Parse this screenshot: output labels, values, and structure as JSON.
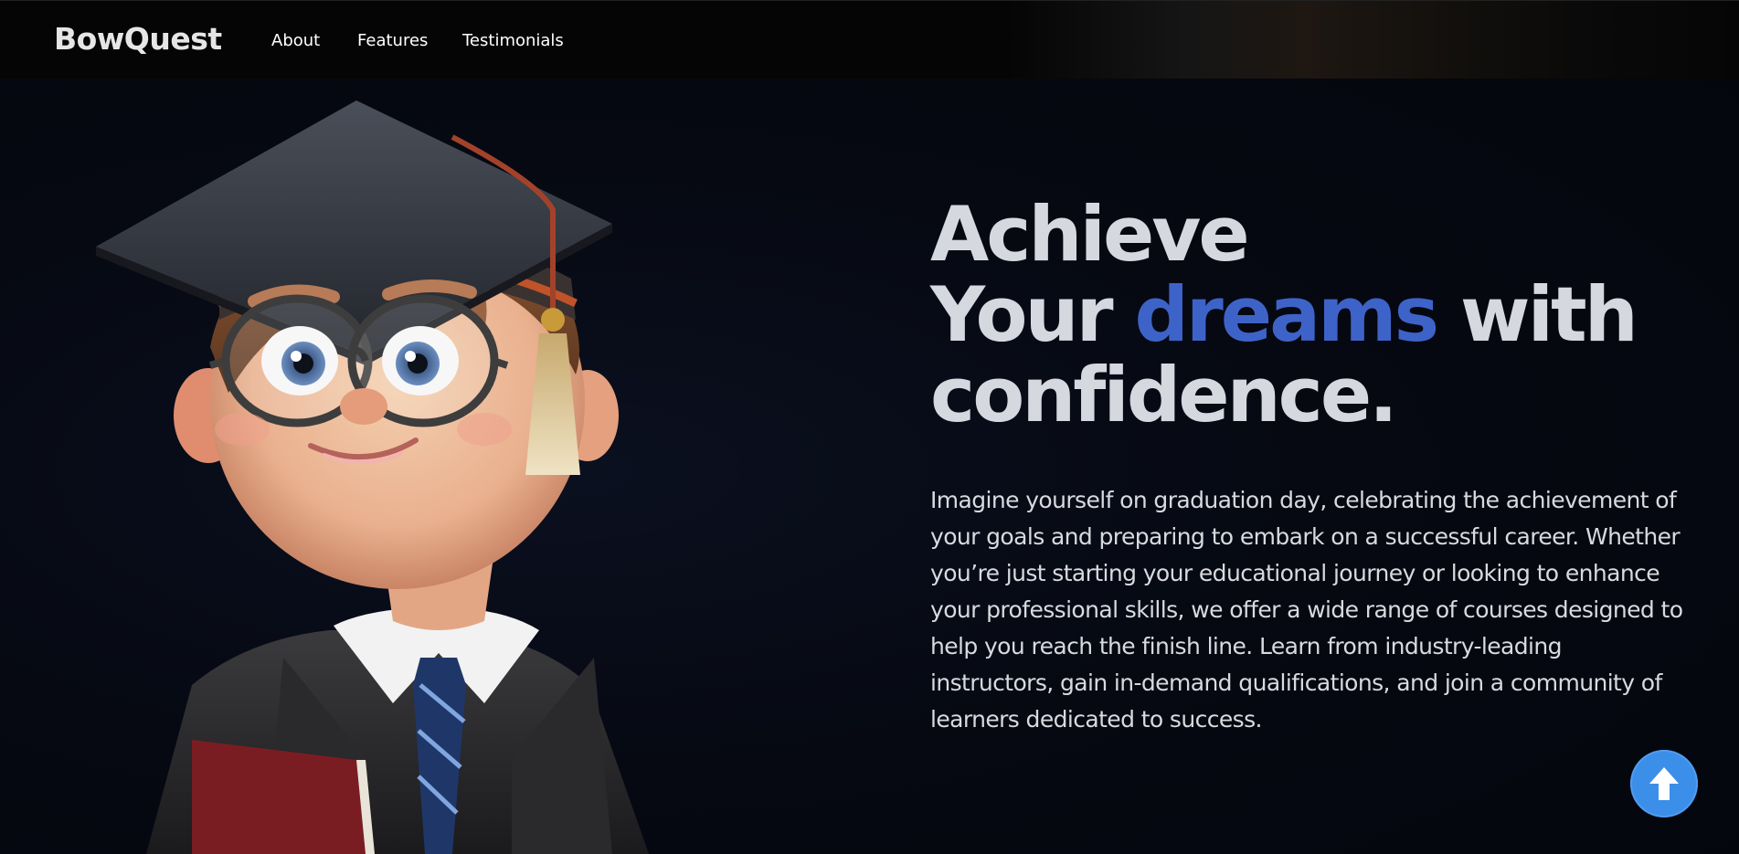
{
  "nav": {
    "brand": "BowQuest",
    "links": [
      "About",
      "Features",
      "Testimonials"
    ]
  },
  "hero": {
    "title_line1": "Achieve",
    "title_line2_start": "Your",
    "title_line2_accent": "dreams",
    "title_line2_end": "with",
    "title_line3": "confidence.",
    "body": "Imagine yourself on graduation day, celebrating the achievement of your goals and preparing to embark on a successful career. Whether you’re just starting your educational journey or looking to enhance your professional skills, we offer a wide range of courses designed to help you reach the finish line. Learn from industry-leading instructors, gain in-demand qualifications, and join a community of learners dedicated to success."
  },
  "scroll_top": {
    "icon": "arrow-up-icon"
  },
  "colors": {
    "background": "#050811",
    "accent": "#3e63c8",
    "scroll_button": "#3c8fe8"
  }
}
